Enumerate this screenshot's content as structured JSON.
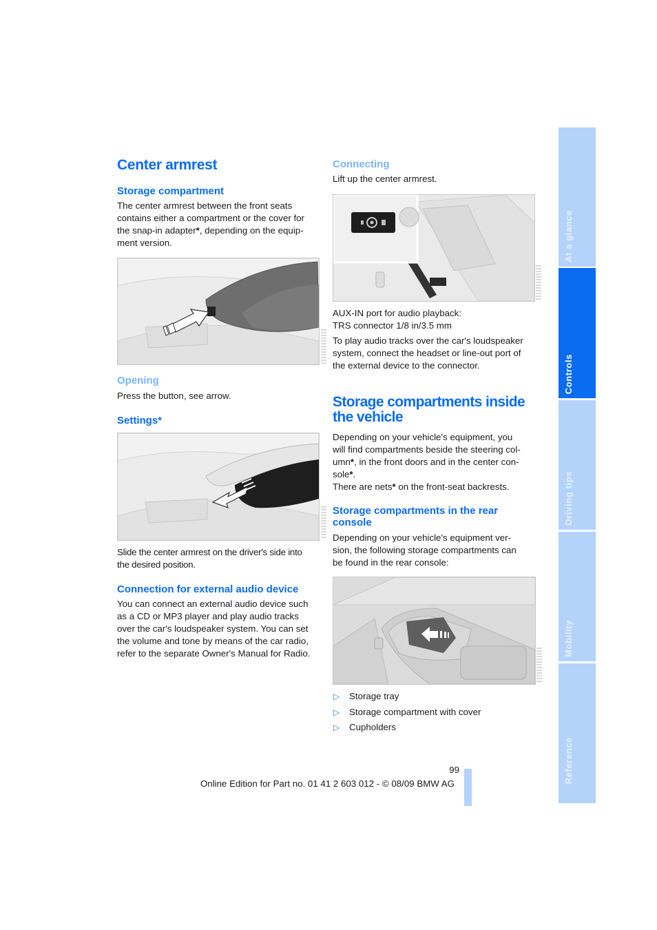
{
  "left_column": {
    "title": "Center armrest",
    "storage_compartment": {
      "heading": "Storage compartment",
      "lines": [
        "The center armrest between the front seats",
        "contains either a compartment or the cover for",
        "the snap-in adapter",
        ", depending on the equip-",
        "ment version."
      ],
      "star": "*"
    },
    "figure1_alt": "Armrest with arrow pointing to button",
    "opening": {
      "heading": "Opening",
      "text": "Press the button, see arrow."
    },
    "settings": {
      "heading": "Settings*"
    },
    "figure2_alt": "Armrest sliding forward",
    "settings_text": [
      "Slide the center armrest on the driver's side into",
      "the desired position."
    ],
    "audio": {
      "heading": "Connection for external audio device",
      "lines": [
        "You can connect an external audio device such",
        "as a CD or MP3 player and play audio tracks",
        "over the car's loudspeaker system. You can set",
        "the volume and tone by means of the car radio,",
        "refer to the separate Owner's Manual for Radio."
      ]
    }
  },
  "right_column": {
    "connecting": {
      "heading": "Connecting",
      "text": "Lift up the center armrest."
    },
    "figure3_alt": "AUX-IN port under armrest",
    "aux_lines": [
      "AUX-IN port for audio playback:",
      "TRS connector 1/8 in/3.5 mm"
    ],
    "aux_para": [
      "To play audio tracks over the car's loudspeaker",
      "system, connect the headset or line-out port of",
      "the external device to the connector."
    ],
    "storage_inside": {
      "title_line1": "Storage compartments inside",
      "title_line2": "the vehicle",
      "l1": "Depending on your vehicle's equipment, you",
      "l2": "will find compartments beside the steering col-",
      "l3a": "umn",
      "l3b": ", in the front doors and in the center con-",
      "l4a": "sole",
      "l4b": ".",
      "l5a": "There are nets",
      "l5b": " on the front-seat backrests.",
      "star": "*"
    },
    "rear_console": {
      "heading_line1": "Storage compartments in the rear",
      "heading_line2": "console",
      "lines": [
        "Depending on your vehicle's equipment ver-",
        "sion, the following storage compartments can",
        "be found in the rear console:"
      ]
    },
    "figure4_alt": "Rear console storage tray",
    "bullet_glyph": "▷",
    "bullets": [
      "Storage tray",
      "Storage compartment with cover",
      "Cupholders"
    ]
  },
  "sidebar": {
    "tabs": [
      {
        "label": "At a glance",
        "active": false
      },
      {
        "label": "Controls",
        "active": true
      },
      {
        "label": "Driving tips",
        "active": false
      },
      {
        "label": "Mobility",
        "active": false
      },
      {
        "label": "Reference",
        "active": false
      }
    ]
  },
  "footer": {
    "page_number": "99",
    "edition": "Online Edition for Part no. 01 41 2 603 012 - © 08/09 BMW AG"
  },
  "colors": {
    "heading": "#0a6cf0",
    "subheading_light": "#7ab4f5",
    "tab_inactive": "#b3d3fb",
    "tab_active": "#0a6cf0"
  }
}
